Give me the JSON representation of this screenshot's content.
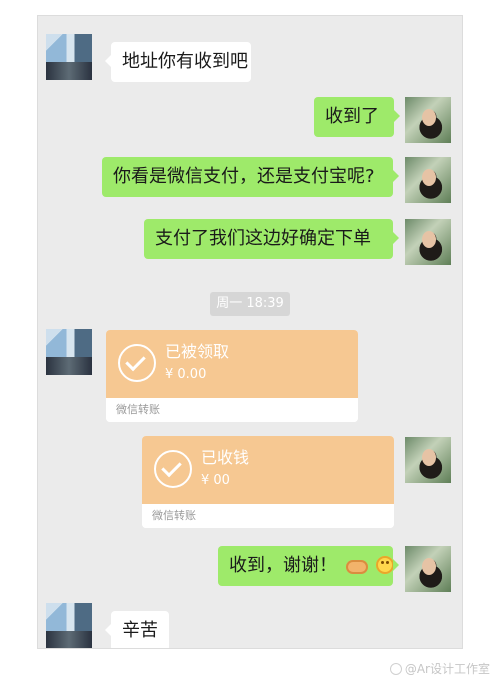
{
  "messages": [
    {
      "side": "left",
      "text": "地址你有收到吧"
    },
    {
      "side": "right",
      "text": "收到了"
    },
    {
      "side": "right",
      "text": "你看是微信支付，还是支付宝呢?"
    },
    {
      "side": "right",
      "text": "支付了我们这边好确定下单"
    },
    {
      "side": "right",
      "text": "收到，谢谢！"
    },
    {
      "side": "left",
      "text": "辛苦"
    }
  ],
  "timestamp": "周一 18:39",
  "transfers": [
    {
      "side": "left",
      "status": "已被领取",
      "amount": "¥  0.00",
      "label": "微信转账"
    },
    {
      "side": "right",
      "status": "已收钱",
      "amount": "¥   00",
      "label": "微信转账"
    }
  ],
  "watermark": "@Ar设计工作室",
  "icons": [
    "avatar-left-icon",
    "avatar-right-icon",
    "check-circle-icon",
    "handshake-icon",
    "smile-icon"
  ],
  "colors": {
    "chat_bg": "#ebebeb",
    "incoming_bubble": "#ffffff",
    "outgoing_bubble": "#9eea6a",
    "transfer_card": "#f6c892"
  }
}
